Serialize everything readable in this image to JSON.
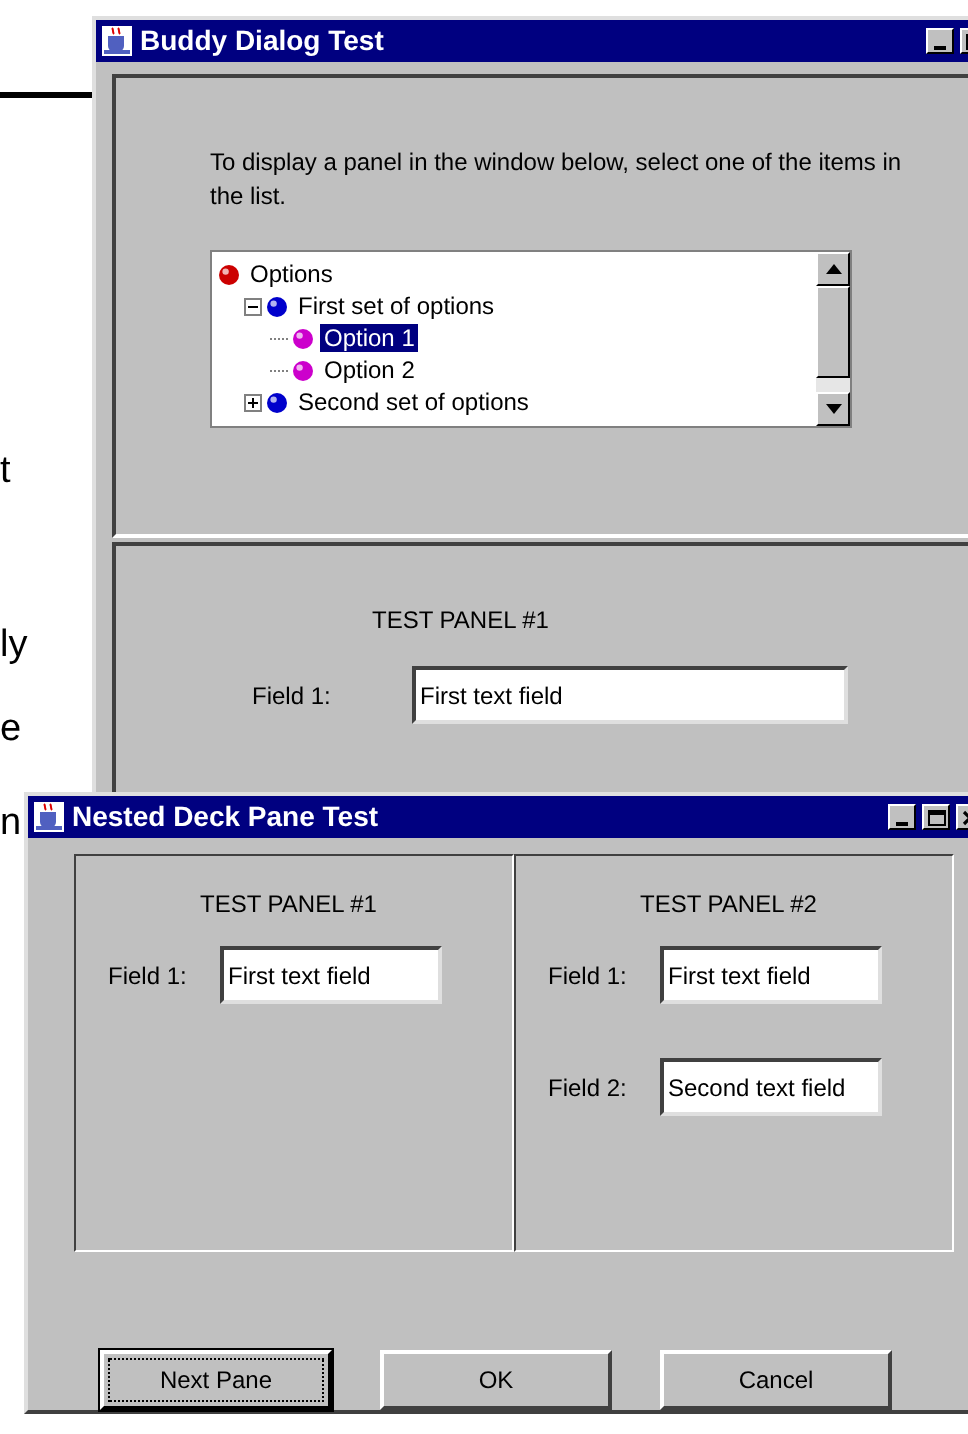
{
  "background_text": [
    "t",
    "ly",
    "e",
    "n"
  ],
  "buddy_dialog": {
    "title": "Buddy Dialog Test",
    "instructions": "To display a panel in the window below, select one of the items in the list.",
    "tree": [
      {
        "label": "Options",
        "color": "#cc0000",
        "selected": false,
        "children": [
          {
            "label": "First set of options",
            "color": "#0000cc",
            "selected": false,
            "expanded": true,
            "children": [
              {
                "label": "Option 1",
                "color": "#cc00cc",
                "selected": true
              },
              {
                "label": "Option 2",
                "color": "#cc00cc",
                "selected": false
              }
            ]
          },
          {
            "label": "Second set of options",
            "color": "#0000cc",
            "selected": false,
            "expanded": false
          }
        ]
      }
    ],
    "panel": {
      "title": "TEST PANEL #1",
      "fields": [
        {
          "label": "Field 1:",
          "value": "First text field"
        }
      ]
    }
  },
  "nested_deck": {
    "title": "Nested Deck Pane Test",
    "panels": [
      {
        "title": "TEST PANEL #1",
        "fields": [
          {
            "label": "Field 1:",
            "value": "First text field"
          }
        ]
      },
      {
        "title": "TEST PANEL #2",
        "fields": [
          {
            "label": "Field 1:",
            "value": "First text field"
          },
          {
            "label": "Field 2:",
            "value": "Second text field"
          }
        ]
      }
    ],
    "buttons": [
      {
        "label": "Next Pane",
        "focused": true
      },
      {
        "label": "OK",
        "focused": false
      },
      {
        "label": "Cancel",
        "focused": false
      }
    ]
  }
}
